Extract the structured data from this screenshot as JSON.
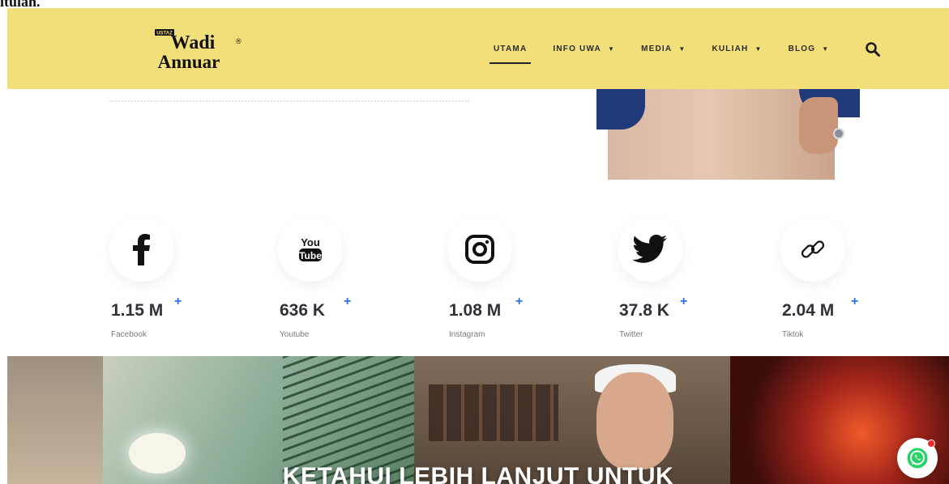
{
  "top_fragment": "itulah.",
  "brand": {
    "logo_small": "USTAZ",
    "logo_line1": "Wadi",
    "logo_line2": "Annuar",
    "registered": "®"
  },
  "nav": {
    "items": [
      {
        "label": "UTAMA",
        "dropdown": false,
        "active": true
      },
      {
        "label": "INFO UWA",
        "dropdown": true,
        "active": false
      },
      {
        "label": "MEDIA",
        "dropdown": true,
        "active": false
      },
      {
        "label": "KULIAH",
        "dropdown": true,
        "active": false
      },
      {
        "label": "BLOG",
        "dropdown": true,
        "active": false
      }
    ],
    "caret": "▼",
    "search_icon": "search-icon"
  },
  "stats": [
    {
      "icon": "facebook-icon",
      "value": "1.15 M",
      "plus": "+",
      "label": "Facebook"
    },
    {
      "icon": "youtube-icon",
      "value": "636 K",
      "plus": "+",
      "label": "Youtube",
      "icon_text_top": "You",
      "icon_text_bottom": "Tube"
    },
    {
      "icon": "instagram-icon",
      "value": "1.08 M",
      "plus": "+",
      "label": "Instagram"
    },
    {
      "icon": "twitter-icon",
      "value": "37.8 K",
      "plus": "+",
      "label": "Twitter"
    },
    {
      "icon": "link-icon",
      "value": "2.04 M",
      "plus": "+",
      "label": "Tiktok"
    }
  ],
  "banner": {
    "title": "KETAHUI LEBIH LANJUT UNTUK"
  },
  "colors": {
    "header_bg": "#f3df7a",
    "plus": "#2e6ff0",
    "whatsapp": "#25d366"
  }
}
